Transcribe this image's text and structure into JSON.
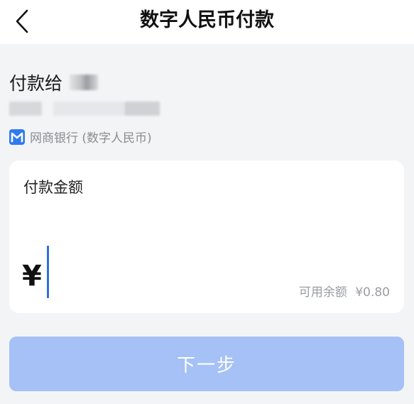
{
  "header": {
    "title": "数字人民币付款",
    "back_icon": "chevron-left-icon"
  },
  "payee": {
    "label": "付款给"
  },
  "bank": {
    "icon": "mybank-logo-icon",
    "name": "网商银行 (数字人民币)",
    "brand_color": "#2f7bf0"
  },
  "amount": {
    "label": "付款金额",
    "currency_symbol": "¥",
    "value": "",
    "available_label": "可用余额",
    "available_value": "¥0.80"
  },
  "actions": {
    "next_label": "下一步",
    "button_color": "#a5c1f6"
  }
}
